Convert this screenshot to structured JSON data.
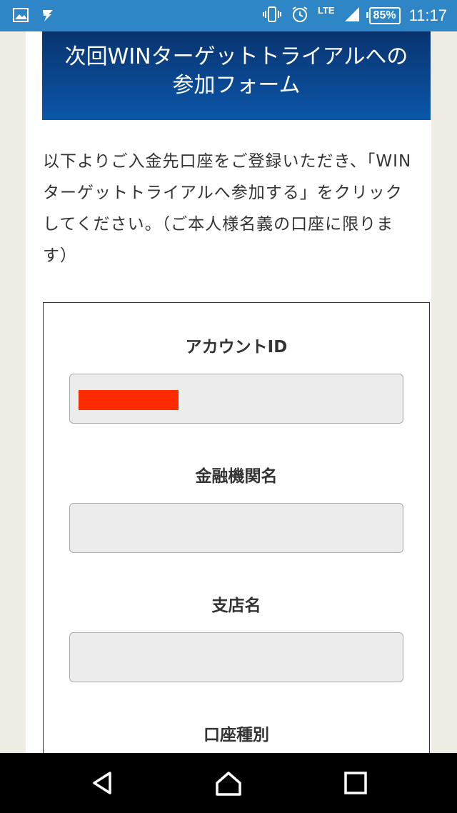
{
  "status_bar": {
    "network": "LTE",
    "battery": "85%",
    "time": "11:17"
  },
  "form": {
    "title_line1": "次回WINターゲットトライアルへの",
    "title_line2": "参加フォーム",
    "intro_lines": [
      "以下よりご入金先口座をご登録いただき、「WIN",
      "ターゲットトライアルへ参加する」をクリック",
      "してください。（ご本人様名義の口座に限りま",
      "す）"
    ],
    "fields": {
      "account_id": {
        "label": "アカウントID",
        "value": ""
      },
      "bank_name": {
        "label": "金融機関名",
        "value": ""
      },
      "branch_name": {
        "label": "支店名",
        "value": ""
      },
      "account_type": {
        "label": "口座種別"
      }
    }
  },
  "colors": {
    "status_bar": "#2f86c7",
    "banner": "#0b4c98",
    "redaction": "#ff2a00",
    "input_bg": "#ececec"
  }
}
